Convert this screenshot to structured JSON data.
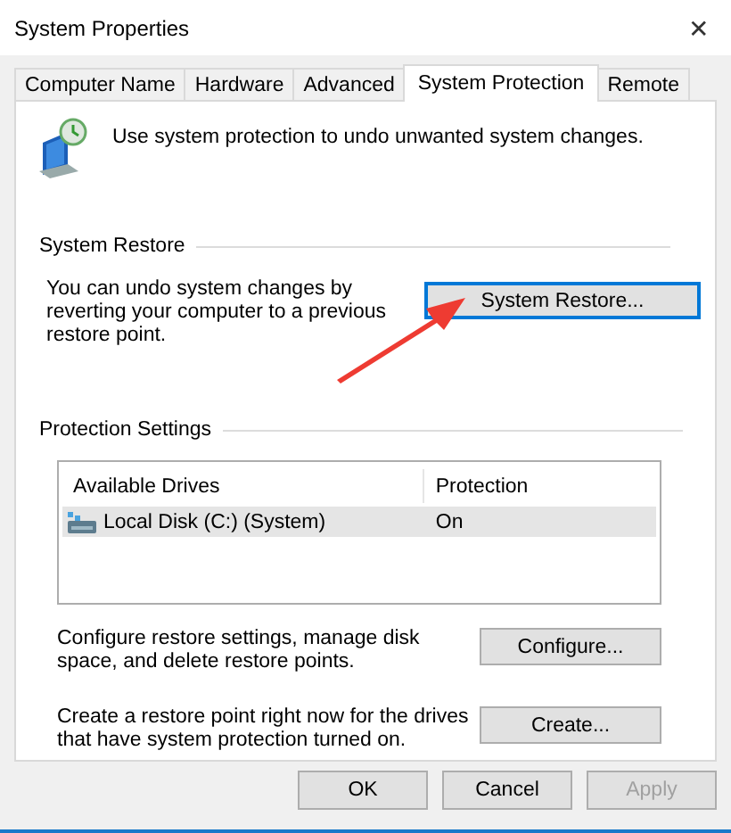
{
  "window": {
    "title": "System Properties",
    "close": "✕"
  },
  "tabs": [
    {
      "label": "Computer Name",
      "selected": false
    },
    {
      "label": "Hardware",
      "selected": false
    },
    {
      "label": "Advanced",
      "selected": false
    },
    {
      "label": "System Protection",
      "selected": true
    },
    {
      "label": "Remote",
      "selected": false
    }
  ],
  "intro": "Use system protection to undo unwanted system changes.",
  "system_restore": {
    "title": "System Restore",
    "description": "You can undo system changes by reverting your computer to a previous restore point.",
    "button": {
      "label": "System Restore...",
      "focused": true
    }
  },
  "protection_settings": {
    "title": "Protection Settings",
    "table": {
      "columns": [
        "Available Drives",
        "Protection"
      ],
      "rows": [
        {
          "drive": "Local Disk (C:) (System)",
          "protection": "On",
          "selected": true
        }
      ]
    },
    "actions": [
      {
        "text": "Configure restore settings, manage disk space, and delete restore points.",
        "button": "Configure..."
      },
      {
        "text": "Create a restore point right now for the drives that have system protection turned on.",
        "button": "Create..."
      }
    ]
  },
  "buttons": [
    {
      "label": "OK",
      "disabled": false
    },
    {
      "label": "Cancel",
      "disabled": false
    },
    {
      "label": "Apply",
      "disabled": true
    }
  ]
}
